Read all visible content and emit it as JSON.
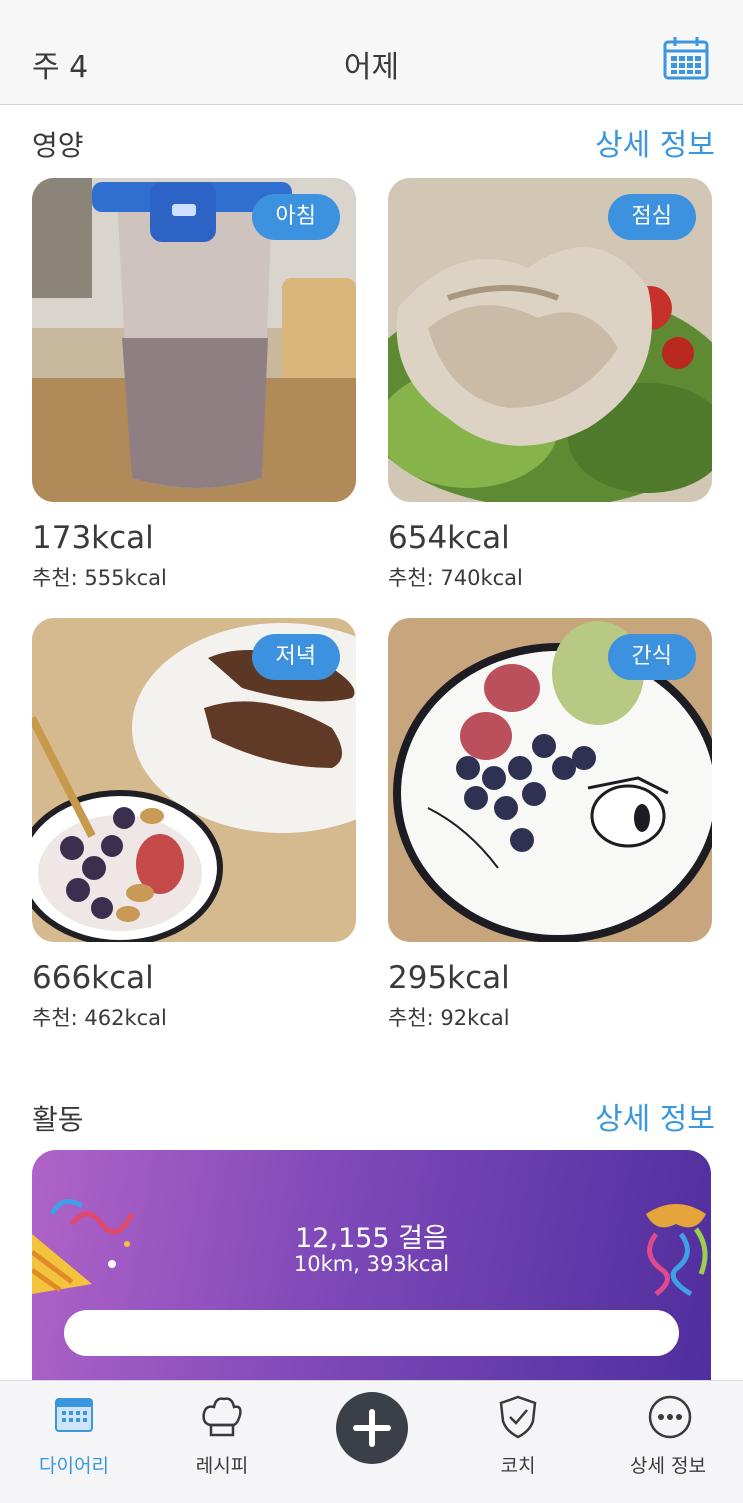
{
  "header": {
    "week": "주 4",
    "title": "어제"
  },
  "nutrition": {
    "title": "영양",
    "detail": "상세 정보",
    "meals": [
      {
        "badge": "아침",
        "kcal": "173kcal",
        "recommended": "추천: 555kcal"
      },
      {
        "badge": "점심",
        "kcal": "654kcal",
        "recommended": "추천: 740kcal"
      },
      {
        "badge": "저녁",
        "kcal": "666kcal",
        "recommended": "추천: 462kcal"
      },
      {
        "badge": "간식",
        "kcal": "295kcal",
        "recommended": "추천: 92kcal"
      }
    ]
  },
  "activity": {
    "title": "활동",
    "detail": "상세 정보",
    "steps": "12,155 걸음",
    "summary": "10km, 393kcal"
  },
  "tabbar": {
    "items": [
      {
        "label": "다이어리",
        "icon": "calendar-icon",
        "active": true
      },
      {
        "label": "레시피",
        "icon": "chef-hat-icon",
        "active": false
      },
      {
        "label": "",
        "icon": "plus-icon",
        "active": false
      },
      {
        "label": "코치",
        "icon": "shield-check-icon",
        "active": false
      },
      {
        "label": "상세 정보",
        "icon": "more-icon",
        "active": false
      }
    ]
  },
  "colors": {
    "accent": "#3b97dd",
    "badge": "#3c92de",
    "activity_start": "#b063c8",
    "activity_end": "#4f2e9d"
  }
}
